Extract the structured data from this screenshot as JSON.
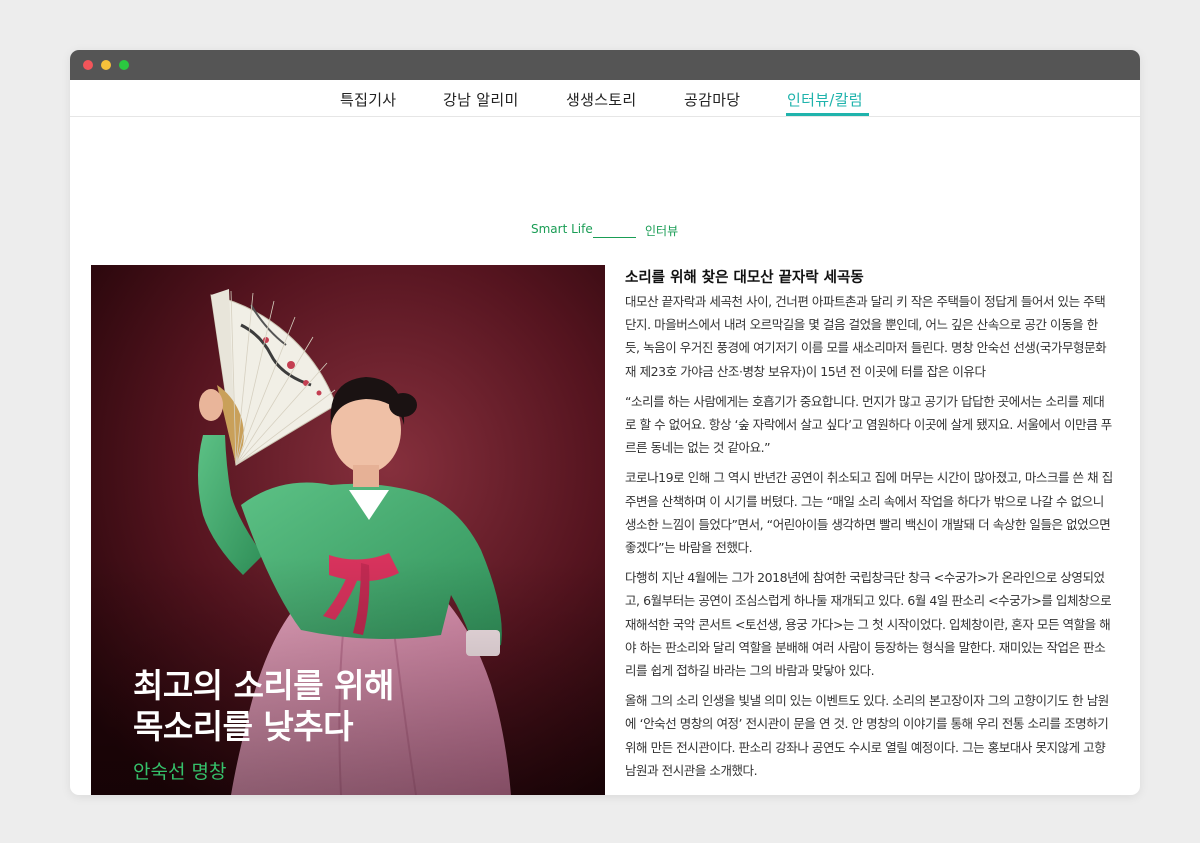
{
  "nav": {
    "items": [
      {
        "label": "특집기사"
      },
      {
        "label": "강남 알리미"
      },
      {
        "label": "생생스토리"
      },
      {
        "label": "공감마당"
      },
      {
        "label": "인터뷰/칼럼"
      }
    ],
    "active_index": 4
  },
  "breadcrumb": {
    "section": "Smart Life",
    "category": "인터뷰"
  },
  "hero": {
    "title_line1": "최고의 소리를 위해",
    "title_line2": "목소리를 낮추다",
    "subtitle": "안숙선 명창"
  },
  "article": {
    "heading": "소리를 위해 찾은 대모산 끝자락 세곡동",
    "paragraphs": [
      "대모산 끝자락과 세곡천 사이, 건너편 아파트촌과 달리 키 작은 주택들이 정답게 들어서 있는 주택단지. 마을버스에서 내려 오르막길을 몇 걸음 걸었을 뿐인데, 어느 깊은 산속으로 공간 이동을 한 듯, 녹음이 우거진 풍경에 여기저기 이름 모를 새소리마저 들린다. 명창 안숙선 선생(국가무형문화재 제23호 가야금 산조·병창 보유자)이 15년 전 이곳에 터를 잡은 이유다",
      "“소리를 하는 사람에게는 호흡기가 중요합니다. 먼지가 많고 공기가 답답한 곳에서는 소리를 제대로 할 수 없어요. 항상 ‘숲 자락에서 살고 싶다’고 염원하다 이곳에 살게 됐지요. 서울에서 이만큼 푸르른 동네는 없는 것 같아요.”",
      "코로나19로 인해 그 역시 반년간 공연이 취소되고 집에 머무는 시간이 많아졌고, 마스크를 쓴 채 집 주변을 산책하며 이 시기를 버텼다. 그는 “매일 소리 속에서 작업을 하다가 밖으로 나갈 수 없으니 생소한 느낌이 들었다”면서, “어린아이들 생각하면 빨리 백신이 개발돼 더 속상한 일들은 없었으면 좋겠다”는 바람을 전했다.",
      "다행히 지난 4월에는 그가 2018년에 참여한 국립창극단 창극 <수궁가>가 온라인으로 상영되었고, 6월부터는 공연이 조심스럽게 하나둘 재개되고 있다. 6월 4일 판소리 <수궁가>를 입체창으로 재해석한 국악 콘서트 <토선생, 용궁 가다>는 그 첫 시작이었다. 입체창이란, 혼자 모든 역할을 해야 하는 판소리와 달리 역할을 분배해 여러 사람이 등장하는 형식을 말한다. 재미있는 작업은 판소리를 쉽게 접하길 바라는 그의 바람과 맞닿아 있다.",
      "올해 그의 소리 인생을 빛낼 의미 있는 이벤트도 있다. 소리의 본고장이자 그의 고향이기도 한 남원에 ‘안숙선 명창의 여정’ 전시관이 문을 연 것. 안 명창의 이야기를 통해 우리 전통 소리를 조명하기 위해 만든 전시관이다. 판소리 강좌나 공연도 수시로 열릴 예정이다. 그는 홍보대사 못지않게 고향 남원과 전시관을 소개했다."
    ]
  }
}
